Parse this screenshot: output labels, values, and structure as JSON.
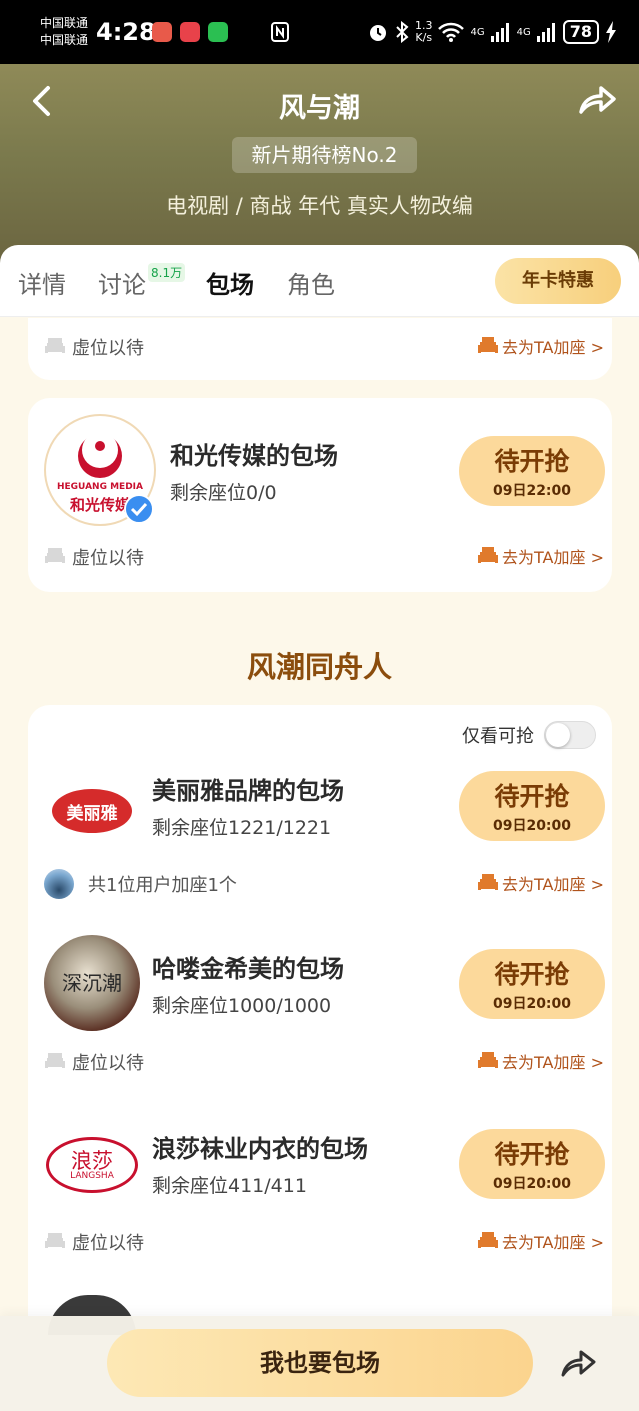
{
  "status_bar": {
    "carrier1": "中国联通",
    "carrier2": "中国联通",
    "time": "4:28",
    "net_speed_value": "1.3",
    "net_speed_unit": "K/s",
    "net1": "4G",
    "net2": "4G",
    "battery": "78"
  },
  "header": {
    "title": "风与潮",
    "rank_badge": "新片期待榜No.2",
    "genre": "电视剧 / 商战 年代 真实人物改编"
  },
  "tabs": {
    "items": [
      "详情",
      "讨论",
      "包场",
      "角色"
    ],
    "discuss_badge": "8.1万",
    "active": "包场",
    "annual_button": "年卡特惠"
  },
  "cards": {
    "partial_top": {
      "status": "虚位以待",
      "go_link": "去为TA加座 >"
    },
    "heguang": {
      "name": "和光传媒的包场",
      "seats": "剩余座位0/0",
      "button_main": "待开抢",
      "button_time": "09日22:00",
      "status": "虚位以待",
      "go_link": "去为TA加座 >",
      "logo_text_en": "HEGUANG MEDIA",
      "logo_text_cn": "和光传媒"
    }
  },
  "section": {
    "title": "风潮同舟人",
    "filter_label": "仅看可抢",
    "filter_on": false
  },
  "list": [
    {
      "name": "美丽雅品牌的包场",
      "seats": "剩余座位1221/1221",
      "button_main": "待开抢",
      "button_time": "09日20:00",
      "status": "共1位用户加座1个",
      "go_link": "去为TA加座 >",
      "logo_text": "美丽雅"
    },
    {
      "name": "哈喽金希美的包场",
      "seats": "剩余座位1000/1000",
      "button_main": "待开抢",
      "button_time": "09日20:00",
      "status": "虚位以待",
      "go_link": "去为TA加座 >",
      "logo_text": "深沉潮"
    },
    {
      "name": "浪莎袜业内衣的包场",
      "seats": "剩余座位411/411",
      "button_main": "待开抢",
      "button_time": "09日20:00",
      "status": "虚位以待",
      "go_link": "去为TA加座 >",
      "logo_text_cn": "浪莎",
      "logo_text_en": "LANGSHA"
    }
  ],
  "bottom_bar": {
    "cta": "我也要包场"
  },
  "colors": {
    "header_bg": "#7b7a4d",
    "page_bg": "#fdf8ea",
    "pill_bg": "#fcd99b",
    "pill_text": "#7a3c05",
    "link": "#b0531b",
    "section_title": "#8b4d0d"
  },
  "icons": [
    "back-icon",
    "share-icon",
    "sofa-icon",
    "seat-add-icon",
    "verified-icon",
    "alarm-icon",
    "bluetooth-icon",
    "wifi-icon",
    "signal-icon",
    "charging-icon"
  ]
}
